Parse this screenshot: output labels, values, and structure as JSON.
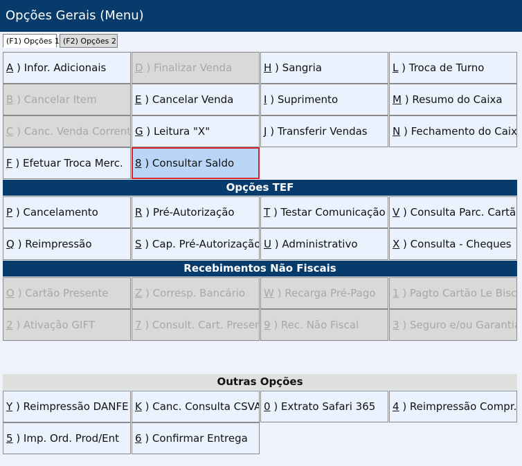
{
  "window": {
    "title": "Opções Gerais (Menu)"
  },
  "tabs": [
    {
      "label": "(F1) Opções 1",
      "active": true
    },
    {
      "label": "(F2) Opções 2",
      "active": false
    }
  ],
  "general": {
    "rows": [
      [
        {
          "key": "A",
          "label": ") Infor. Adicionais",
          "state": "enabled"
        },
        {
          "key": "D",
          "label": ") Finalizar Venda",
          "state": "disabled"
        },
        {
          "key": "H",
          "label": ") Sangria",
          "state": "enabled"
        },
        {
          "key": "L",
          "label": ") Troca de Turno",
          "state": "enabled"
        }
      ],
      [
        {
          "key": "B",
          "label": ") Cancelar Item",
          "state": "disabled"
        },
        {
          "key": "E",
          "label": ") Cancelar Venda",
          "state": "enabled"
        },
        {
          "key": "I",
          "label": ") Suprimento",
          "state": "enabled"
        },
        {
          "key": "M",
          "label": ") Resumo do Caixa",
          "state": "enabled"
        }
      ],
      [
        {
          "key": "C",
          "label": ") Canc. Venda Corrente",
          "state": "disabled"
        },
        {
          "key": "G",
          "label": ") Leitura \"X\"",
          "state": "enabled"
        },
        {
          "key": "J",
          "label": ") Transferir Vendas",
          "state": "enabled"
        },
        {
          "key": "N",
          "label": ") Fechamento do Caixa",
          "state": "enabled"
        }
      ],
      [
        {
          "key": "F",
          "label": ") Efetuar Troca Merc.",
          "state": "enabled"
        },
        {
          "key": "8",
          "label": ") Consultar Saldo",
          "state": "selected"
        }
      ]
    ]
  },
  "tef": {
    "title": "Opções TEF",
    "rows": [
      [
        {
          "key": "P",
          "label": ") Cancelamento",
          "state": "enabled"
        },
        {
          "key": "R",
          "label": ") Pré-Autorização",
          "state": "enabled"
        },
        {
          "key": "T",
          "label": ") Testar Comunicação",
          "state": "enabled"
        },
        {
          "key": "V",
          "label": ") Consulta Parc. Cartão",
          "state": "enabled"
        }
      ],
      [
        {
          "key": "Q",
          "label": ") Reimpressão",
          "state": "enabled"
        },
        {
          "key": "S",
          "label": ") Cap. Pré-Autorização",
          "state": "enabled"
        },
        {
          "key": "U",
          "label": ") Administrativo",
          "state": "enabled"
        },
        {
          "key": "X",
          "label": ") Consulta - Cheques",
          "state": "enabled"
        }
      ]
    ]
  },
  "receipts": {
    "title": "Recebimentos Não Fiscais",
    "rows": [
      [
        {
          "key": "O",
          "label": ") Cartão Presente",
          "state": "disabled"
        },
        {
          "key": "Z",
          "label": ") Corresp. Bancário",
          "state": "disabled"
        },
        {
          "key": "W",
          "label": ") Recarga Pré-Pago",
          "state": "disabled"
        },
        {
          "key": "1",
          "label": ") Pagto Cartão Le Biscuit",
          "state": "disabled"
        }
      ],
      [
        {
          "key": "2",
          "label": ") Ativação GIFT",
          "state": "disabled"
        },
        {
          "key": "7",
          "label": ") Consult. Cart. Presente",
          "state": "disabled"
        },
        {
          "key": "9",
          "label": ") Rec. Não Fiscal",
          "state": "disabled"
        },
        {
          "key": "3",
          "label": ") Seguro e/ou Garantia",
          "state": "disabled"
        }
      ]
    ]
  },
  "other": {
    "title": "Outras Opções",
    "rows": [
      [
        {
          "key": "Y",
          "label": ") Reimpressão DANFE",
          "state": "enabled"
        },
        {
          "key": "K",
          "label": ") Canc. Consulta CSVA",
          "state": "enabled"
        },
        {
          "key": "0",
          "label": ") Extrato Safari 365",
          "state": "enabled"
        },
        {
          "key": "4",
          "label": ") Reimpressão Compr.",
          "state": "enabled"
        }
      ],
      [
        {
          "key": "5",
          "label": ") Imp. Ord. Prod/Ent",
          "state": "enabled"
        },
        {
          "key": "6",
          "label": ") Confirmar Entrega",
          "state": "enabled"
        }
      ]
    ]
  }
}
